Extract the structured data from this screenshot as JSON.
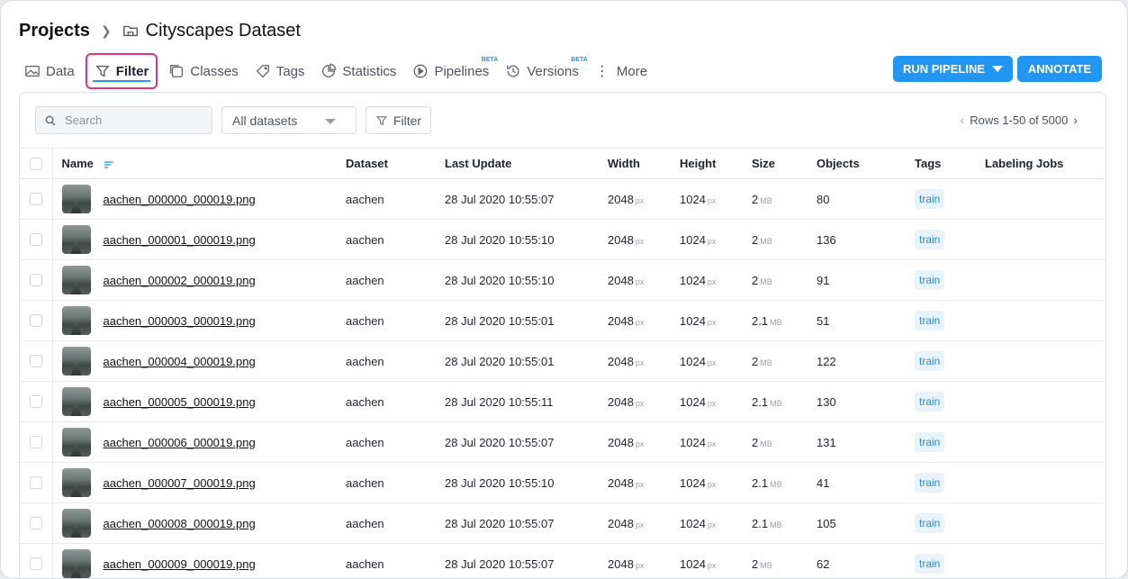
{
  "breadcrumb": {
    "root": "Projects",
    "current": "Cityscapes Dataset"
  },
  "tabs": [
    {
      "label": "Data",
      "icon": "image-icon"
    },
    {
      "label": "Filter",
      "icon": "filter-icon",
      "active": true
    },
    {
      "label": "Classes",
      "icon": "classes-icon"
    },
    {
      "label": "Tags",
      "icon": "tag-icon"
    },
    {
      "label": "Statistics",
      "icon": "pie-chart-icon"
    },
    {
      "label": "Pipelines",
      "icon": "play-icon",
      "badge": "BETA"
    },
    {
      "label": "Versions",
      "icon": "history-icon",
      "badge": "BETA"
    },
    {
      "label": "More",
      "icon": "more-dots-icon"
    }
  ],
  "actions": {
    "run_pipeline": "RUN PIPELINE",
    "annotate": "ANNOTATE"
  },
  "toolbar": {
    "search_placeholder": "Search",
    "dataset_select": "All datasets",
    "filter_label": "Filter",
    "pagination": "Rows 1-50 of 5000"
  },
  "table": {
    "headers": [
      "Name",
      "Dataset",
      "Last Update",
      "Width",
      "Height",
      "Size",
      "Objects",
      "Tags",
      "Labeling Jobs"
    ],
    "rows": [
      {
        "name": "aachen_000000_000019.png",
        "dataset": "aachen",
        "updated": "28 Jul 2020 10:55:07",
        "width": "2048",
        "width_unit": "px",
        "height": "1024",
        "height_unit": "px",
        "size": "2",
        "size_unit": "MB",
        "objects": "80",
        "tag": "train"
      },
      {
        "name": "aachen_000001_000019.png",
        "dataset": "aachen",
        "updated": "28 Jul 2020 10:55:10",
        "width": "2048",
        "width_unit": "px",
        "height": "1024",
        "height_unit": "px",
        "size": "2",
        "size_unit": "MB",
        "objects": "136",
        "tag": "train"
      },
      {
        "name": "aachen_000002_000019.png",
        "dataset": "aachen",
        "updated": "28 Jul 2020 10:55:10",
        "width": "2048",
        "width_unit": "px",
        "height": "1024",
        "height_unit": "px",
        "size": "2",
        "size_unit": "MB",
        "objects": "91",
        "tag": "train"
      },
      {
        "name": "aachen_000003_000019.png",
        "dataset": "aachen",
        "updated": "28 Jul 2020 10:55:01",
        "width": "2048",
        "width_unit": "px",
        "height": "1024",
        "height_unit": "px",
        "size": "2.1",
        "size_unit": "MB",
        "objects": "51",
        "tag": "train"
      },
      {
        "name": "aachen_000004_000019.png",
        "dataset": "aachen",
        "updated": "28 Jul 2020 10:55:01",
        "width": "2048",
        "width_unit": "px",
        "height": "1024",
        "height_unit": "px",
        "size": "2",
        "size_unit": "MB",
        "objects": "122",
        "tag": "train"
      },
      {
        "name": "aachen_000005_000019.png",
        "dataset": "aachen",
        "updated": "28 Jul 2020 10:55:11",
        "width": "2048",
        "width_unit": "px",
        "height": "1024",
        "height_unit": "px",
        "size": "2.1",
        "size_unit": "MB",
        "objects": "130",
        "tag": "train"
      },
      {
        "name": "aachen_000006_000019.png",
        "dataset": "aachen",
        "updated": "28 Jul 2020 10:55:07",
        "width": "2048",
        "width_unit": "px",
        "height": "1024",
        "height_unit": "px",
        "size": "2",
        "size_unit": "MB",
        "objects": "131",
        "tag": "train"
      },
      {
        "name": "aachen_000007_000019.png",
        "dataset": "aachen",
        "updated": "28 Jul 2020 10:55:10",
        "width": "2048",
        "width_unit": "px",
        "height": "1024",
        "height_unit": "px",
        "size": "2.1",
        "size_unit": "MB",
        "objects": "41",
        "tag": "train"
      },
      {
        "name": "aachen_000008_000019.png",
        "dataset": "aachen",
        "updated": "28 Jul 2020 10:55:07",
        "width": "2048",
        "width_unit": "px",
        "height": "1024",
        "height_unit": "px",
        "size": "2.1",
        "size_unit": "MB",
        "objects": "105",
        "tag": "train"
      },
      {
        "name": "aachen_000009_000019.png",
        "dataset": "aachen",
        "updated": "28 Jul 2020 10:55:07",
        "width": "2048",
        "width_unit": "px",
        "height": "1024",
        "height_unit": "px",
        "size": "2",
        "size_unit": "MB",
        "objects": "62",
        "tag": "train"
      }
    ]
  },
  "colors": {
    "accent": "#2196f3",
    "active_outline": "#e0347d",
    "tag_bg": "#e8f3fc"
  }
}
